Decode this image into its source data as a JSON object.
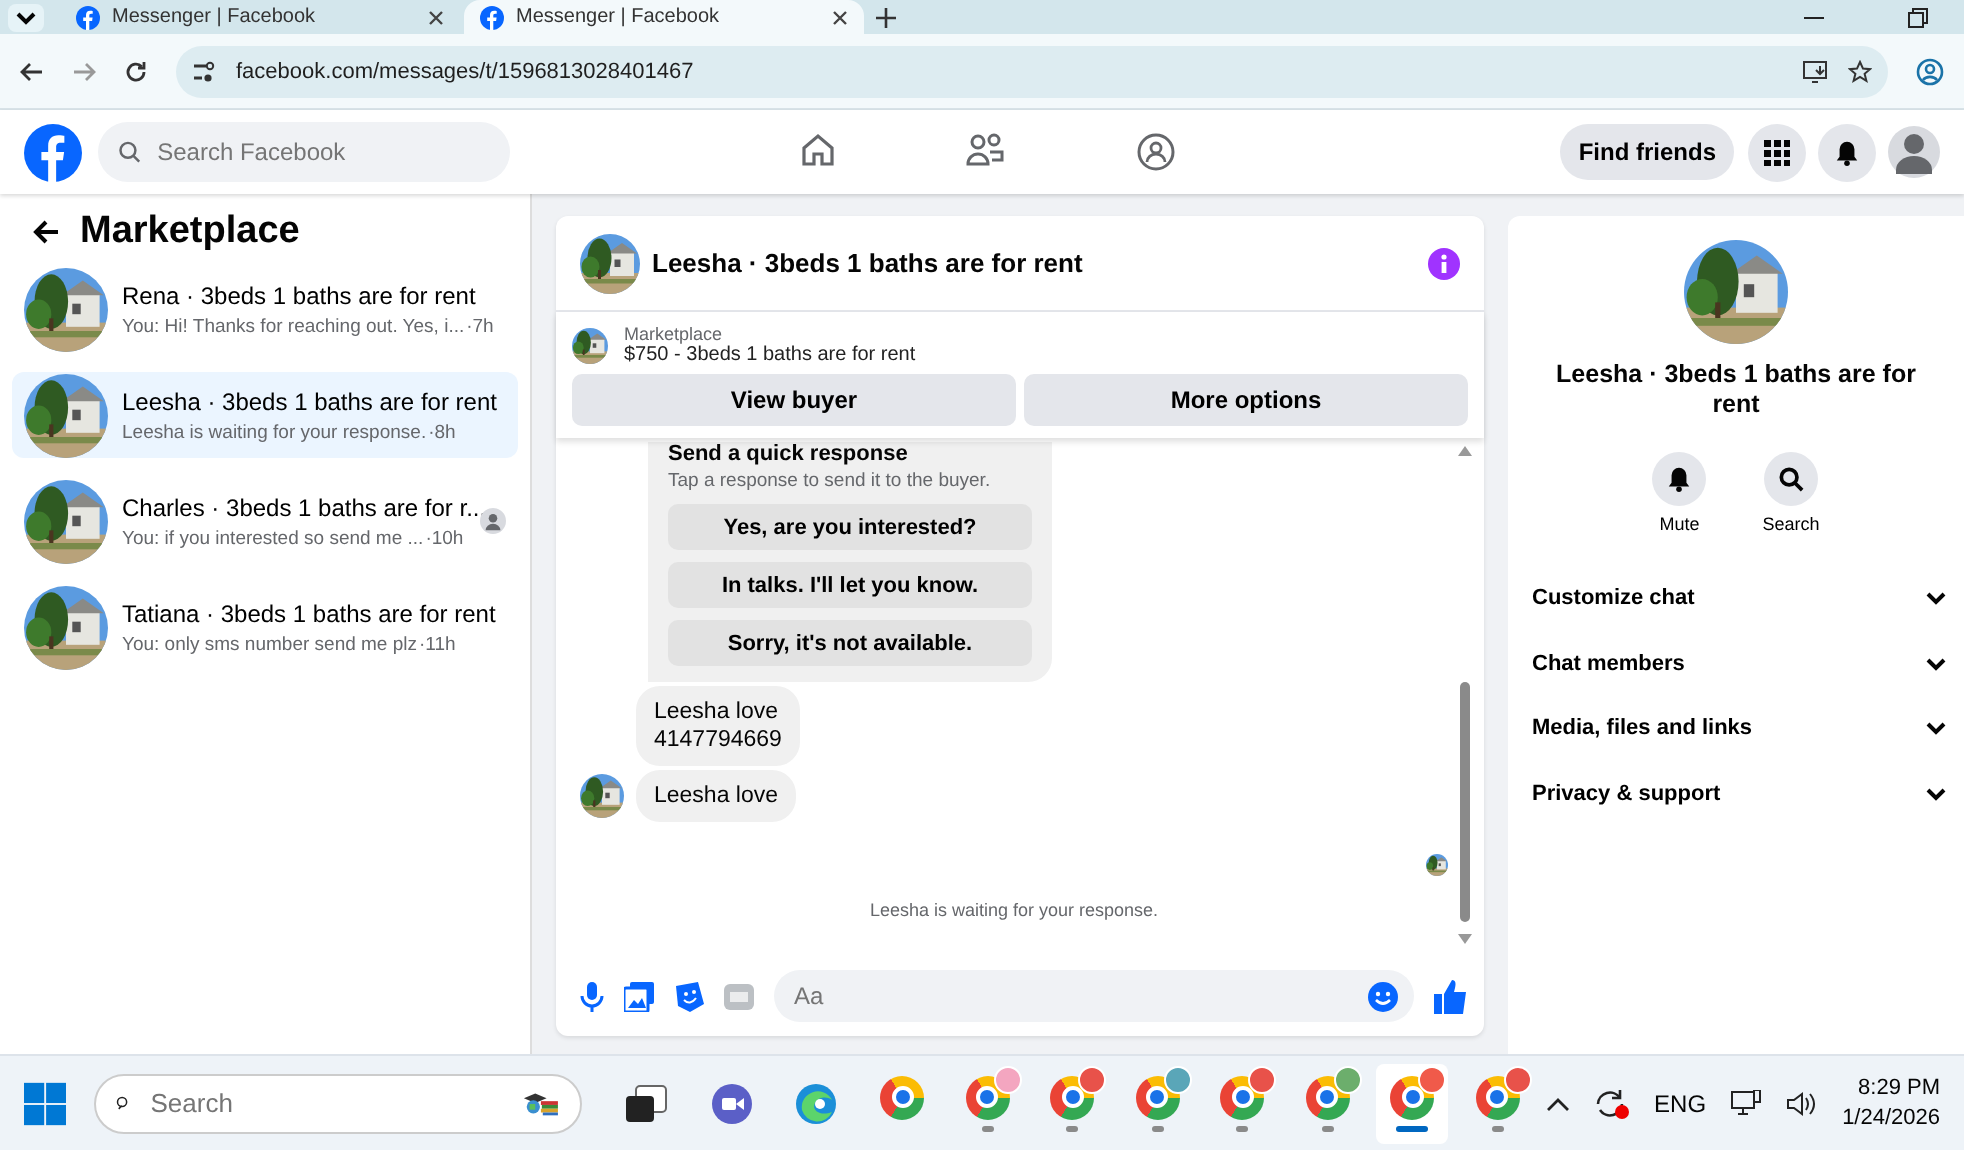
{
  "browser": {
    "tabs": [
      {
        "title": "Messenger | Facebook",
        "selected": false
      },
      {
        "title": "Messenger | Facebook",
        "selected": true
      }
    ],
    "url": "facebook.com/messages/t/1596813028401467"
  },
  "header": {
    "search": {
      "placeholder": "Search Facebook"
    },
    "nav": [
      {
        "kind": "home"
      },
      {
        "kind": "friends"
      },
      {
        "kind": "groups"
      }
    ],
    "find_friends": "Find friends"
  },
  "sidebar": {
    "title": "Marketplace",
    "chats": [
      {
        "name": "Rena · 3beds 1 baths are for rent",
        "preview": "You: Hi! Thanks for reaching out. Yes, i...",
        "time": "·7h",
        "selected": false,
        "seen": false
      },
      {
        "name": "Leesha · 3beds 1 baths are for rent",
        "preview": "Leesha is waiting for your response.",
        "time": "·8h",
        "selected": true,
        "seen": false
      },
      {
        "name": "Charles · 3beds 1 baths are for r...",
        "preview": "You: if you interested so send me ...",
        "time": "·10h",
        "selected": false,
        "seen": true
      },
      {
        "name": "Tatiana · 3beds 1 baths are for rent",
        "preview": "You: only sms number send me plz",
        "time": "·11h",
        "selected": false,
        "seen": false
      }
    ]
  },
  "chat": {
    "title": "Leesha · 3beds 1 baths are for rent",
    "listing": {
      "label": "Marketplace",
      "title": "$750 - 3beds 1 baths are for rent",
      "buttons": [
        "View buyer",
        "More options"
      ]
    },
    "quick_response": {
      "title": "Send a quick response",
      "hint": "Tap a response to send it to the buyer.",
      "options": [
        "Yes, are you interested?",
        "In talks. I'll let you know.",
        "Sorry, it's not available."
      ]
    },
    "messages": [
      {
        "text": "Leesha love\n4147794669",
        "avatar": false
      },
      {
        "text": "Leesha love",
        "avatar": true
      }
    ],
    "status": "Leesha is waiting for your response.",
    "composer": {
      "placeholder": "Aa"
    }
  },
  "details": {
    "name": "Leesha · 3beds 1 baths are for rent",
    "actions": [
      {
        "kind": "mute",
        "label": "Mute"
      },
      {
        "kind": "search",
        "label": "Search"
      }
    ],
    "sections": [
      "Customize chat",
      "Chat members",
      "Media, files and links",
      "Privacy & support"
    ]
  },
  "taskbar": {
    "search": {
      "placeholder": "Search"
    },
    "apps": [
      {
        "kind": "taskview"
      },
      {
        "kind": "meet"
      },
      {
        "kind": "edge"
      },
      {
        "kind": "chrome",
        "running": false,
        "active": false
      },
      {
        "kind": "chrome",
        "color": "#f4a6c0",
        "running": true,
        "active": false
      },
      {
        "kind": "chrome",
        "color": "#e8524a",
        "running": true,
        "active": false
      },
      {
        "kind": "chrome",
        "color": "#5aa6b8",
        "running": true,
        "active": false
      },
      {
        "kind": "chrome",
        "color": "#e8524a",
        "running": true,
        "active": false
      },
      {
        "kind": "chrome",
        "color": "#6cae6c",
        "running": true,
        "active": false
      },
      {
        "kind": "chrome",
        "color": "#f05a4a",
        "running": true,
        "active": true
      },
      {
        "kind": "chrome",
        "color": "#e8524a",
        "running": true,
        "active": false
      }
    ],
    "language": "ENG",
    "time": "8:29 PM",
    "date": "1/24/2026"
  }
}
